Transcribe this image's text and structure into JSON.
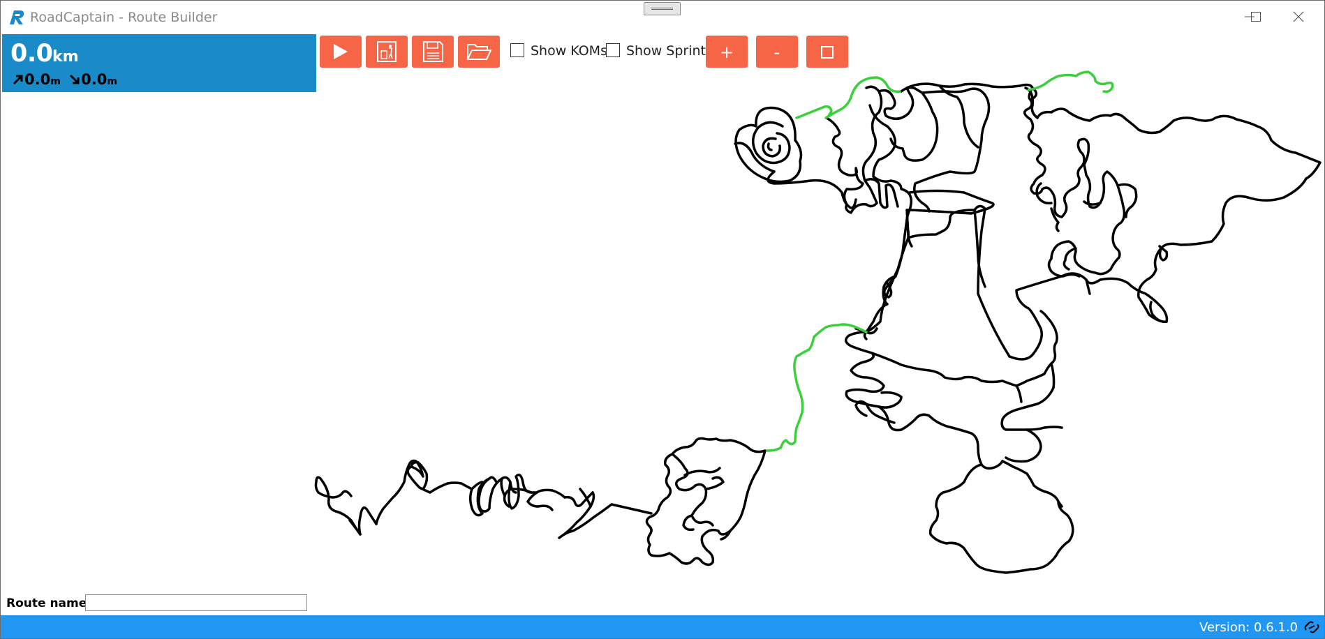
{
  "window": {
    "title": "RoadCaptain - Route Builder",
    "controls": [
      "minimize",
      "maximize",
      "close"
    ]
  },
  "stats": {
    "distance_value": "0.0",
    "distance_unit": "km",
    "ascent_value": "0.0",
    "ascent_unit": "m",
    "descent_value": "0.0",
    "descent_unit": "m",
    "ascent_icon": "arrow-up-right-icon",
    "descent_icon": "arrow-down-right-icon",
    "background_color": "#1a8bc9"
  },
  "toolbar": {
    "buttons": [
      {
        "name": "play-button",
        "icon": "play-icon"
      },
      {
        "name": "clear-route-button",
        "icon": "trash-icon"
      },
      {
        "name": "save-button",
        "icon": "floppy-disk-icon"
      },
      {
        "name": "open-button",
        "icon": "folder-open-icon"
      }
    ],
    "show_koms_label": "Show KOMs",
    "show_koms_checked": false,
    "show_sprints_label": "Show Sprints",
    "show_sprints_checked": false,
    "zoom_in_label": "+",
    "zoom_out_label": "-",
    "reset_zoom_icon": "square-icon",
    "button_color": "#f76547"
  },
  "map": {
    "road_color": "#000000",
    "segment_highlight_color": "#3ccf3c"
  },
  "route": {
    "label": "Route name:",
    "value": ""
  },
  "status": {
    "version": "Version: 0.6.1.0",
    "icon": "link-icon",
    "background_color": "#2196f3"
  }
}
